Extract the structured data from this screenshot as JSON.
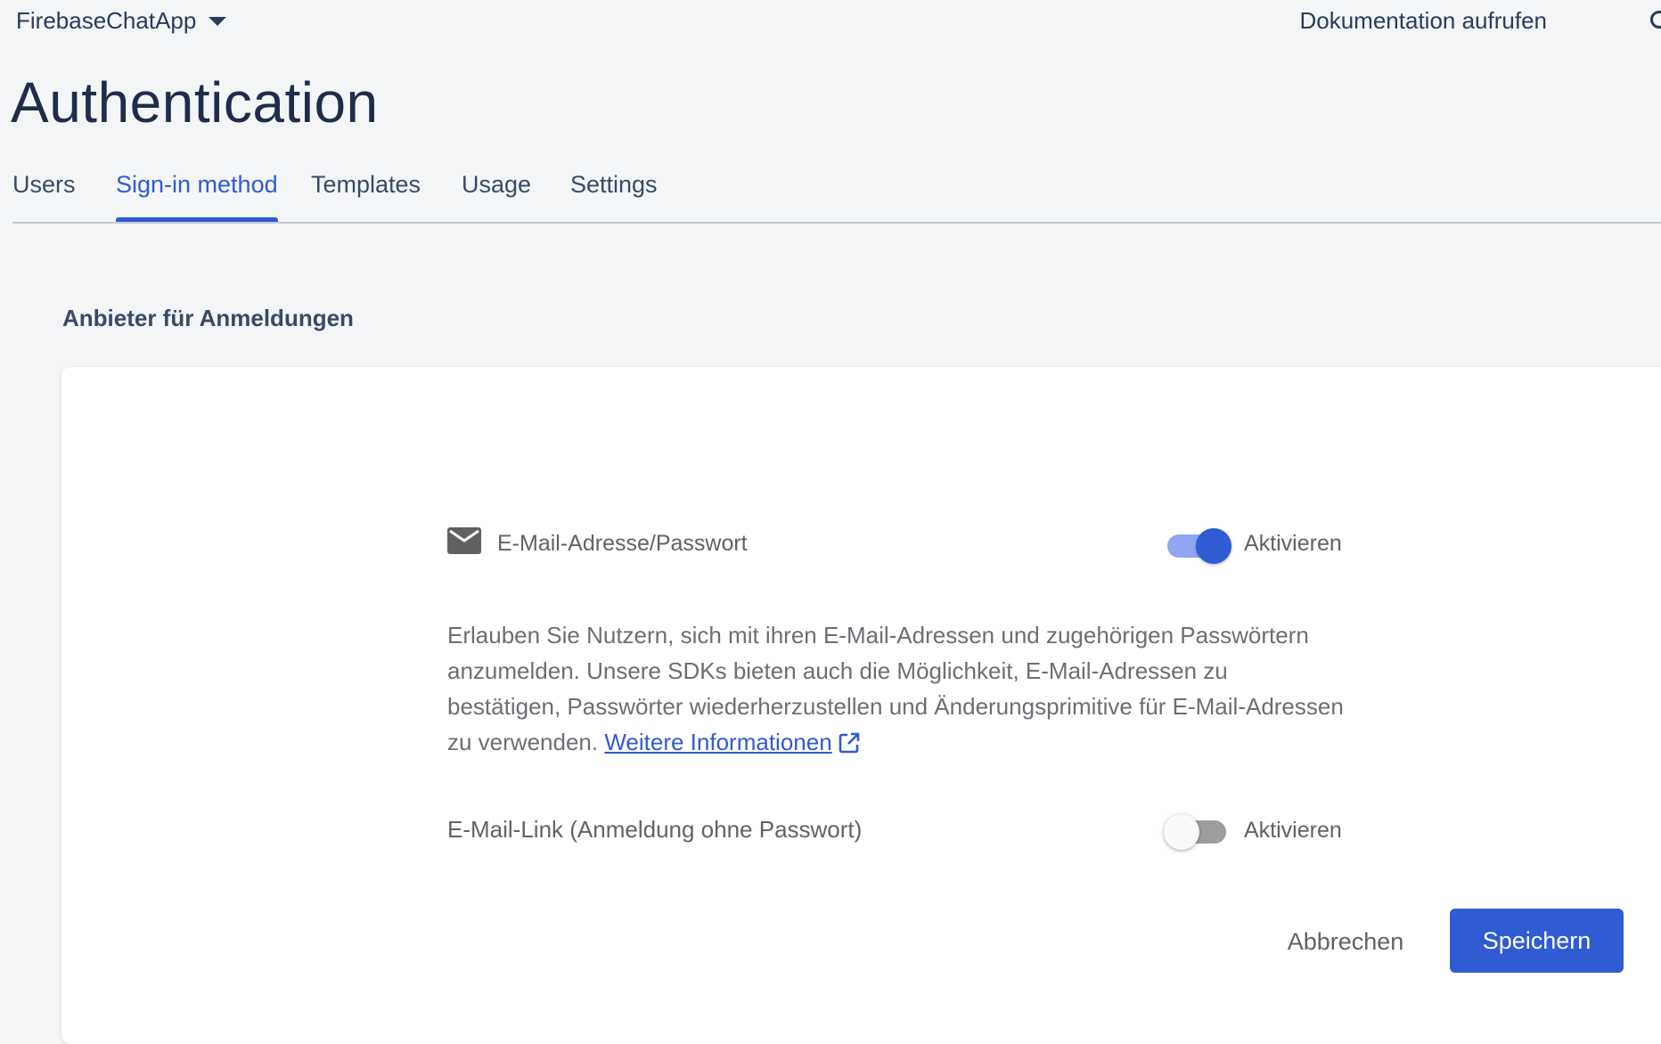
{
  "header": {
    "project_name": "FirebaseChatApp",
    "docs_link": "Dokumentation aufrufen",
    "project_caret_icon": "caret-down-icon",
    "account_icon": "account-icon"
  },
  "page": {
    "title": "Authentication"
  },
  "tabs": [
    {
      "label": "Users",
      "active": false
    },
    {
      "label": "Sign-in method",
      "active": true
    },
    {
      "label": "Templates",
      "active": false
    },
    {
      "label": "Usage",
      "active": false
    },
    {
      "label": "Settings",
      "active": false
    }
  ],
  "section": {
    "title": "Anbieter für Anmeldungen"
  },
  "provider": {
    "icon": "mail-icon",
    "name": "E-Mail-Adresse/Passwort",
    "enabled": true,
    "toggle_label": "Aktivieren",
    "description": "Erlauben Sie Nutzern, sich mit ihren E-Mail-Adressen und zugehörigen Passwörtern anzumelden. Unsere SDKs bieten auch die Möglichkeit, E-Mail-Adressen zu bestätigen, Passwörter wiederherzustellen und Änderungsprimitive für E-Mail-Adressen zu verwenden.",
    "more_link": "Weitere Informationen",
    "more_link_icon": "external-link-icon",
    "email_link": {
      "label": "E-Mail-Link (Anmeldung ohne Passwort)",
      "enabled": false,
      "toggle_label": "Aktivieren"
    }
  },
  "actions": {
    "cancel": "Abbrechen",
    "save": "Speichern"
  },
  "colors": {
    "accent": "#2f5bd3",
    "background": "#f4f5f7",
    "card": "#ffffff"
  }
}
